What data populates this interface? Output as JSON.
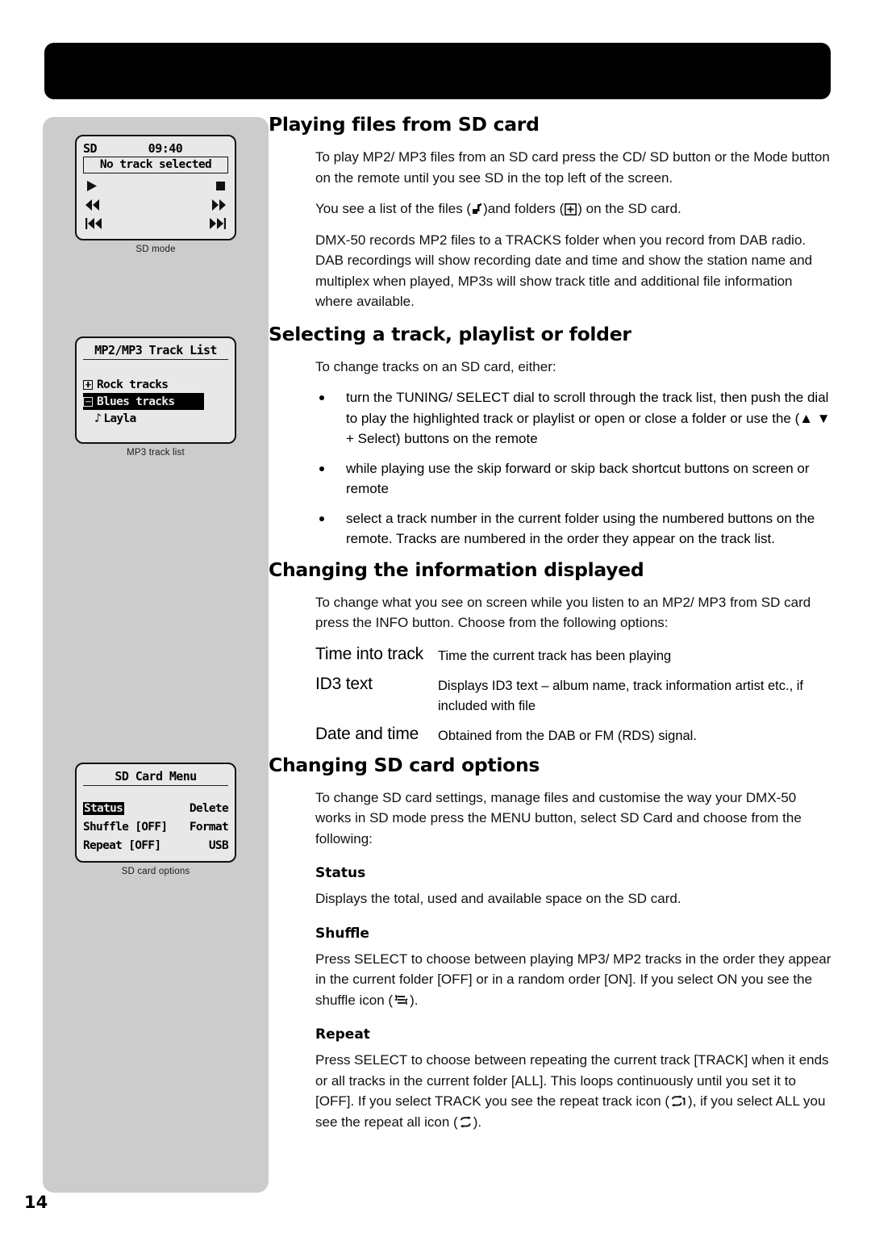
{
  "page": {
    "number": "14"
  },
  "figures": [
    {
      "id": "sd-mode",
      "caption": "SD mode",
      "screen": {
        "mode": "SD",
        "clock": "09:40",
        "track_line": "No track selected",
        "controls": [
          "play",
          "stop",
          "rewind",
          "fast-forward",
          "skip-back",
          "skip-forward"
        ]
      }
    },
    {
      "id": "mp3-track-list",
      "caption": "MP3 track list",
      "screen": {
        "title": "MP2/MP3 Track List",
        "rows": [
          {
            "label": "Rock tracks",
            "marker": "plus",
            "selected": false
          },
          {
            "label": "Blues tracks",
            "marker": "minus",
            "selected": true
          },
          {
            "label": "Layla",
            "marker": "note",
            "selected": false
          }
        ]
      }
    },
    {
      "id": "sd-card-options",
      "caption": "SD card options",
      "screen": {
        "title": "SD Card Menu",
        "rows": [
          {
            "left": "Status",
            "left_selected": true,
            "right": "Delete"
          },
          {
            "left": "Shuffle [OFF]",
            "left_selected": false,
            "right": "Format"
          },
          {
            "left": "Repeat [OFF]",
            "left_selected": false,
            "right": "USB"
          }
        ]
      }
    }
  ],
  "sections": {
    "playing": {
      "title": "Playing files from SD card",
      "p1": "To play MP2/ MP3 files from an SD card press the CD/ SD button or the Mode button on the remote until you see SD in the top left of the screen.",
      "p2_before": "You see a list of the files (",
      "p2_mid": ")and folders (",
      "p2_after": ") on the SD card.",
      "p3": "DMX-50 records MP2 files to a TRACKS folder when you record from DAB radio. DAB recordings will show recording date and time and show the station name and multiplex when played, MP3s will show track title and additional file information where available."
    },
    "selecting": {
      "title": "Selecting a track, playlist or folder",
      "intro": "To change tracks on an SD card, either:",
      "bullets": [
        "turn the TUNING/ SELECT dial to scroll through the track list, then push the dial to play the highlighted track or playlist or open or close a folder or use the (▲ ▼ + Select) buttons on the remote",
        "while playing use the skip forward or skip back shortcut buttons on screen or remote",
        "select a track number in the current folder using the numbered buttons on the remote. Tracks are numbered in the order they appear on the track list."
      ]
    },
    "information": {
      "title": "Changing the information displayed",
      "intro": "To change what you see on screen while you listen to an MP2/ MP3 from SD card press the INFO button. Choose from the following options:",
      "options": [
        {
          "term": "Time into track",
          "desc": "Time the current track has been playing"
        },
        {
          "term": "ID3 text",
          "desc": "Displays ID3 text – album name, track information artist etc., if included with file"
        },
        {
          "term": "Date and time",
          "desc": "Obtained from the DAB or FM (RDS) signal."
        }
      ]
    },
    "options": {
      "title": "Changing SD card options",
      "intro": "To change SD card settings, manage files and customise the way your DMX-50 works in SD mode press the MENU button, select SD Card and choose from the following:",
      "status_heading": "Status",
      "status_text": "Displays the total, used and available space on the SD card.",
      "shuffle_heading": "Shuffle",
      "shuffle_before": "Press SELECT to choose between playing MP3/ MP2 tracks in the order they appear in the current folder [OFF] or in a random order [ON]. If you select ON you see the shuffle icon (",
      "shuffle_after": ").",
      "repeat_heading": "Repeat",
      "repeat_before": "Press SELECT to choose between repeating the current track [TRACK] when it ends or all tracks in the current folder [ALL]. This loops continuously until you set it to [OFF]. If you select TRACK you see the repeat track icon (",
      "repeat_mid": "), if you select ALL you see the repeat all icon (",
      "repeat_after": ")."
    }
  }
}
